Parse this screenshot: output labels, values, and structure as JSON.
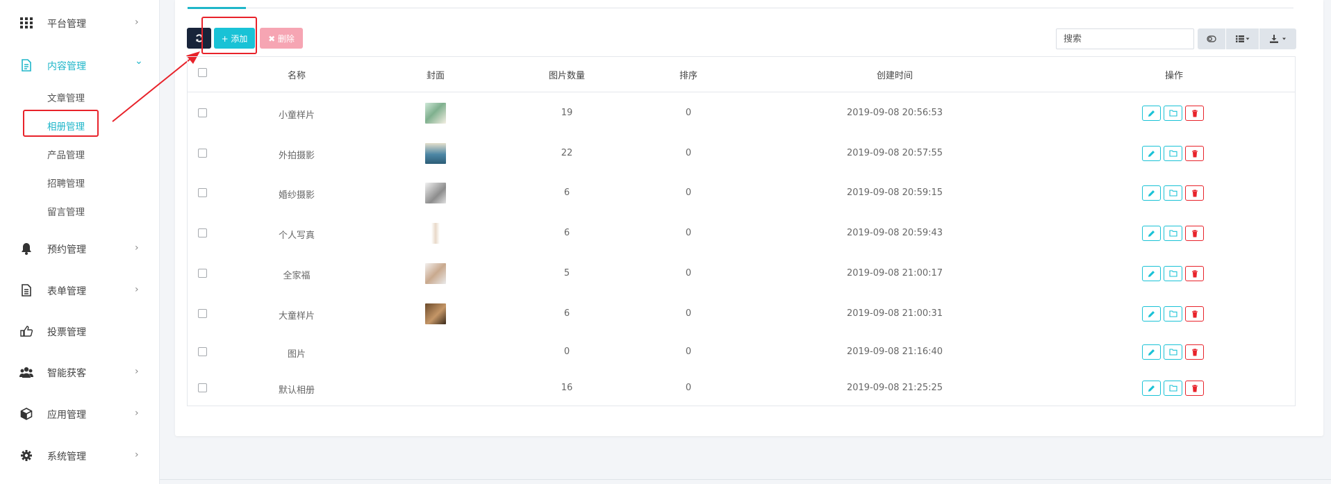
{
  "sidebar": {
    "items": [
      {
        "label": "平台管理",
        "icon": "grid-icon",
        "chevron": "›"
      },
      {
        "label": "内容管理",
        "icon": "document-icon",
        "chevron": "⌄"
      },
      {
        "label": "预约管理",
        "icon": "bell-icon",
        "chevron": "›"
      },
      {
        "label": "表单管理",
        "icon": "file-text-icon",
        "chevron": "›"
      },
      {
        "label": "投票管理",
        "icon": "thumbs-up-icon"
      },
      {
        "label": "智能获客",
        "icon": "users-icon",
        "chevron": "›"
      },
      {
        "label": "应用管理",
        "icon": "cube-icon",
        "chevron": "›"
      },
      {
        "label": "系统管理",
        "icon": "gear-icon",
        "chevron": "›"
      }
    ],
    "subitems": [
      "文章管理",
      "相册管理",
      "产品管理",
      "招聘管理",
      "留言管理"
    ]
  },
  "toolbar": {
    "add_label": "+ 添加",
    "delete_label": "✖ 删除",
    "search_placeholder": "搜索"
  },
  "table": {
    "columns": [
      "名称",
      "封面",
      "图片数量",
      "排序",
      "创建时间",
      "操作"
    ],
    "rows": [
      {
        "name": "小童样片",
        "count": "19",
        "sort": "0",
        "created": "2019-09-08 20:56:53"
      },
      {
        "name": "外拍摄影",
        "count": "22",
        "sort": "0",
        "created": "2019-09-08 20:57:55"
      },
      {
        "name": "婚纱摄影",
        "count": "6",
        "sort": "0",
        "created": "2019-09-08 20:59:15"
      },
      {
        "name": "个人写真",
        "count": "6",
        "sort": "0",
        "created": "2019-09-08 20:59:43"
      },
      {
        "name": "全家福",
        "count": "5",
        "sort": "0",
        "created": "2019-09-08 21:00:17"
      },
      {
        "name": "大童样片",
        "count": "6",
        "sort": "0",
        "created": "2019-09-08 21:00:31"
      },
      {
        "name": "图片",
        "count": "0",
        "sort": "0",
        "created": "2019-09-08 21:16:40"
      },
      {
        "name": "默认相册",
        "count": "16",
        "sort": "0",
        "created": "2019-09-08 21:25:25"
      }
    ]
  },
  "colors": {
    "accent": "#1fb6c9",
    "annotation": "#e8222a",
    "danger": "#e8222a"
  }
}
